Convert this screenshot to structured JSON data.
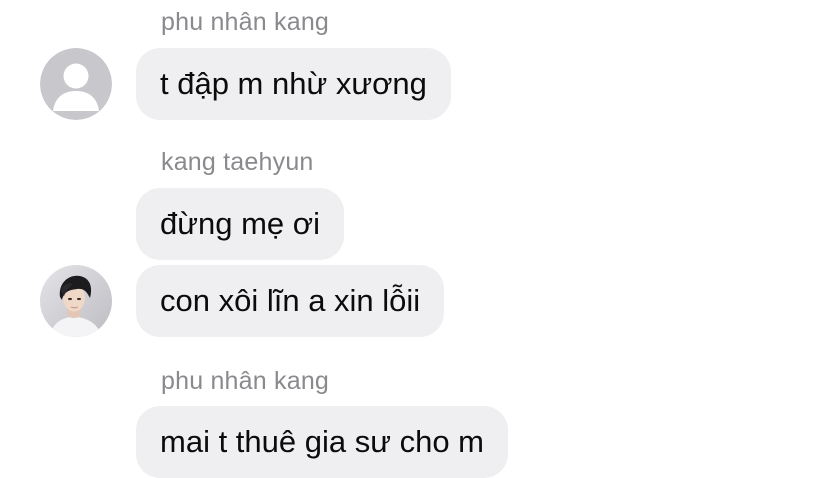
{
  "messages": [
    {
      "sender": "phu nhân kang",
      "bubbles": [
        "t đập m nhừ xương"
      ],
      "avatar": "default-person-icon"
    },
    {
      "sender": "kang taehyun",
      "bubbles": [
        "đừng mẹ ơi",
        "con xôi lĩn a xin lỗii"
      ],
      "avatar": "profile-photo-avatar"
    },
    {
      "sender": "phu nhân kang",
      "bubbles": [
        "mai t thuê gia sư cho m"
      ],
      "avatar": "default-person-icon"
    }
  ],
  "colors": {
    "bubble_background": "#efeff1",
    "sender_text": "#8a8a8e",
    "message_text": "#0b0b0b",
    "default_avatar_bg": "#c8c8cc"
  }
}
